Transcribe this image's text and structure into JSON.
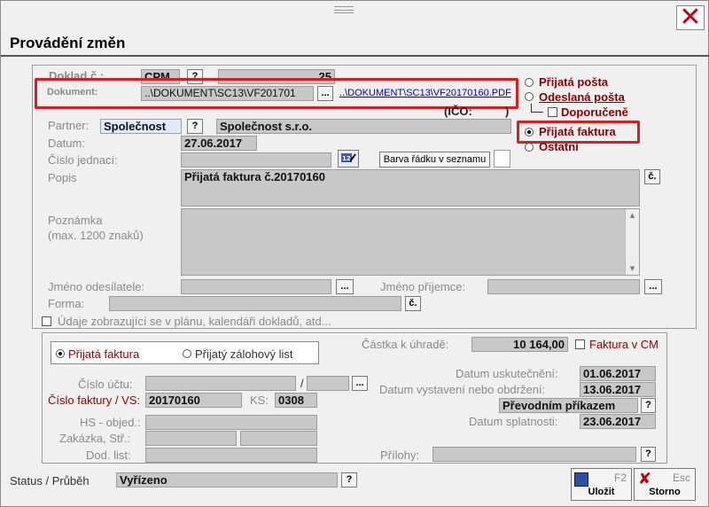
{
  "title": "Provádění změn",
  "doc": {
    "doklad_label": "Doklad č.:",
    "doklad_code": "CPM",
    "doklad_q": "?",
    "doklad_num": "25",
    "dokument_label": "Dokument:",
    "dokument_path": "..\\DOKUMENT\\SC13\\VF201701",
    "dokument_browse": "...",
    "dokument_link": "..\\DOKUMENT\\SC13\\VF20170160.PDF",
    "ico": "(IČO:",
    "ico_close": ")",
    "partner_label": "Partner:",
    "partner_value": "Společnost",
    "partner_q": "?",
    "partner_name": "Společnost s.r.o.",
    "datum_label": "Datum:",
    "datum_value": "27.06.2017",
    "cislo_label": "Číslo jednací:",
    "barva_label": "Barva řádku v seznamu",
    "popis_label": "Popis",
    "popis_value": "Přijatá faktura č.20170160",
    "popis_c": "č.",
    "poznamka_label": "Poznámka",
    "poznamka_sub": "(max. 1200 znaků)",
    "odesilatel_label": "Jméno odesílatele:",
    "prijemce_label": "Jméno příjemce:",
    "browse": "...",
    "forma_label": "Forma:",
    "forma_c": "č.",
    "udaje_label": "Údaje zobrazující se v plánu, kalendáři dokladů, atd..."
  },
  "types": {
    "prijata_posta": "Přijatá pošta",
    "odeslana_posta": "Odeslaná pošta",
    "doporucene": "Doporučeně",
    "prijata_faktura": "Přijatá faktura",
    "ostatni": "Ostatní"
  },
  "invoice": {
    "tab_faktura": "Přijatá faktura",
    "tab_zalohovy": "Přijatý zálohový list",
    "castka_label": "Částka k úhradě:",
    "castka_value": "10 164,00",
    "faktura_cm": "Faktura v CM",
    "cislo_uctu_label": "Číslo účtu:",
    "slash": "/",
    "cislo_faktury_label": "Číslo faktury / VS:",
    "cislo_faktury_value": "20170160",
    "ks_label": "KS:",
    "ks_value": "0308",
    "datum_usk_label": "Datum uskutečnění:",
    "datum_usk_value": "01.06.2017",
    "datum_vyst_label": "Datum vystavení nebo obdržení:",
    "datum_vyst_value": "13.06.2017",
    "platba": "Převodním příkazem",
    "platba_q": "?",
    "datum_splat_label": "Datum splatnosti:",
    "datum_splat_value": "23.06.2017",
    "hs_label": "HS - objed.:",
    "zakazka_label": "Zakázka, Stř.:",
    "dod_label": "Dod. list:",
    "prilohy_label": "Přílohy:",
    "prilohy_q": "?"
  },
  "status": {
    "label": "Status / Průběh",
    "value": "Vyřízeno",
    "q": "?"
  },
  "buttons": {
    "save_key": "F2",
    "save_label": "Uložit",
    "cancel_key": "Esc",
    "cancel_label": "Storno"
  },
  "close_glyph": "✕"
}
